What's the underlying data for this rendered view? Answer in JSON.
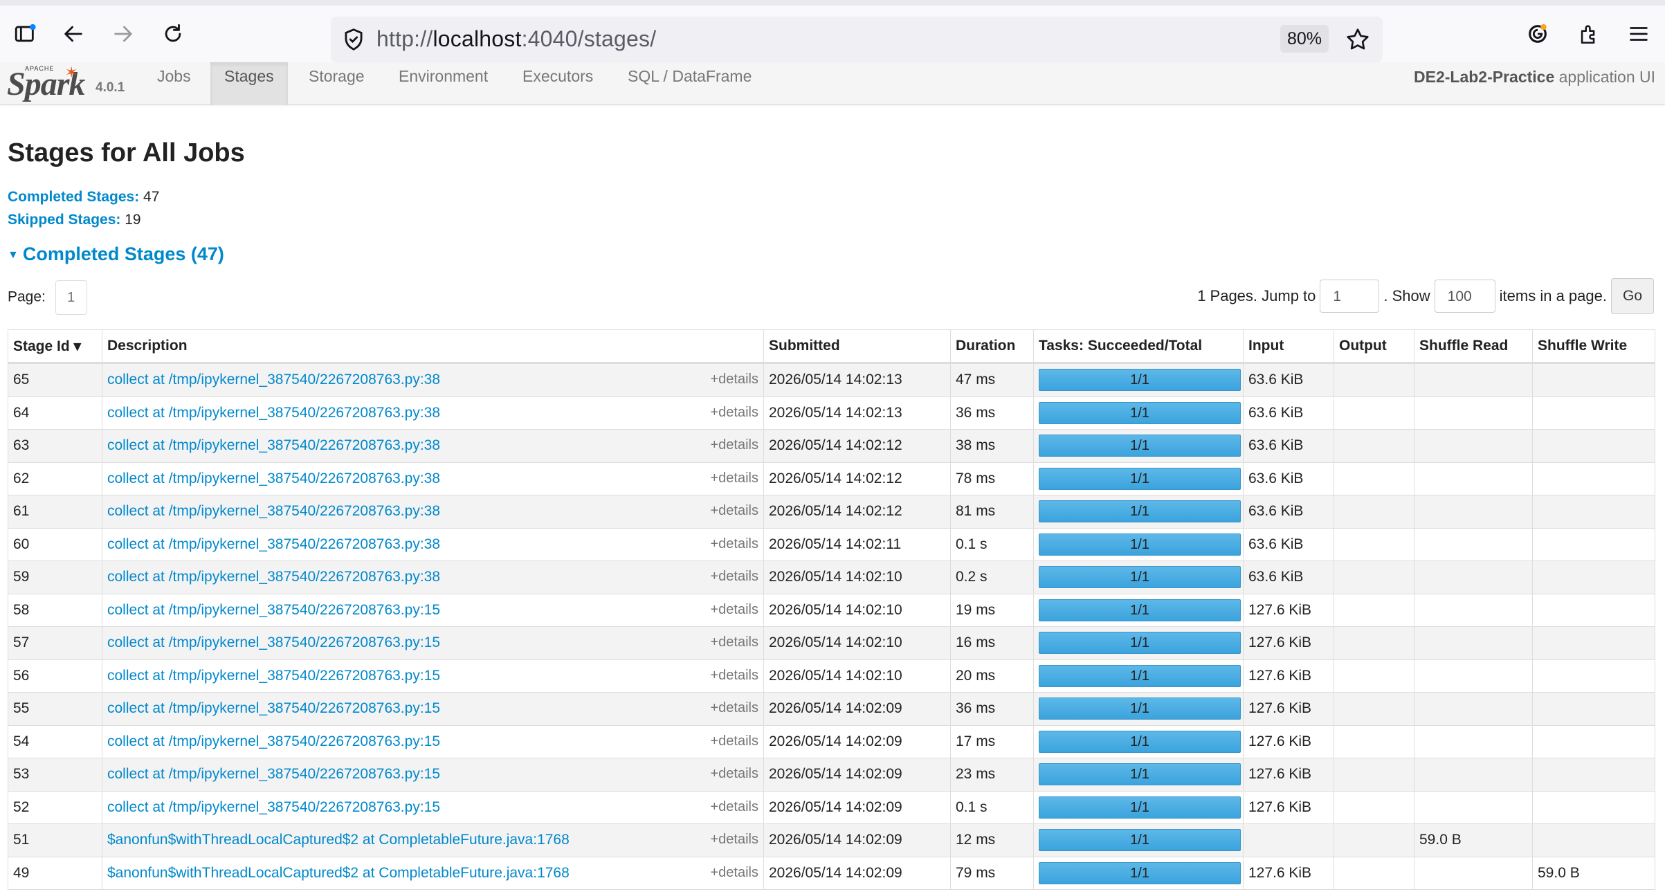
{
  "browser": {
    "url_scheme": "http://",
    "url_host": "localhost",
    "url_rest": ":4040/stages/",
    "zoom": "80%"
  },
  "nav": {
    "version": "4.0.1",
    "items": [
      "Jobs",
      "Stages",
      "Storage",
      "Environment",
      "Executors",
      "SQL / DataFrame"
    ],
    "active": "Stages",
    "app_name": "DE2-Lab2-Practice",
    "app_suffix": " application UI"
  },
  "page": {
    "title": "Stages for All Jobs",
    "completed_label": "Completed Stages:",
    "completed_value": " 47",
    "skipped_label": "Skipped Stages:",
    "skipped_value": " 19",
    "section_title": "Completed Stages (47)"
  },
  "pager": {
    "page_label": "Page:",
    "page_current": "1",
    "pages_text": "1 Pages. Jump to",
    "jump_value": "1",
    "show_text": ". Show",
    "show_value": "100",
    "items_text": "items in a page.",
    "go_label": "Go"
  },
  "table": {
    "headers": [
      "Stage Id ▾",
      "Description",
      "Submitted",
      "Duration",
      "Tasks: Succeeded/Total",
      "Input",
      "Output",
      "Shuffle Read",
      "Shuffle Write"
    ],
    "details_label": "+details",
    "rows": [
      {
        "id": "65",
        "desc": "collect at /tmp/ipykernel_387540/2267208763.py:38",
        "submitted": "2026/05/14 14:02:13",
        "duration": "47 ms",
        "tasks": "1/1",
        "input": "63.6 KiB",
        "output": "",
        "shuffle_read": "",
        "shuffle_write": ""
      },
      {
        "id": "64",
        "desc": "collect at /tmp/ipykernel_387540/2267208763.py:38",
        "submitted": "2026/05/14 14:02:13",
        "duration": "36 ms",
        "tasks": "1/1",
        "input": "63.6 KiB",
        "output": "",
        "shuffle_read": "",
        "shuffle_write": ""
      },
      {
        "id": "63",
        "desc": "collect at /tmp/ipykernel_387540/2267208763.py:38",
        "submitted": "2026/05/14 14:02:12",
        "duration": "38 ms",
        "tasks": "1/1",
        "input": "63.6 KiB",
        "output": "",
        "shuffle_read": "",
        "shuffle_write": ""
      },
      {
        "id": "62",
        "desc": "collect at /tmp/ipykernel_387540/2267208763.py:38",
        "submitted": "2026/05/14 14:02:12",
        "duration": "78 ms",
        "tasks": "1/1",
        "input": "63.6 KiB",
        "output": "",
        "shuffle_read": "",
        "shuffle_write": ""
      },
      {
        "id": "61",
        "desc": "collect at /tmp/ipykernel_387540/2267208763.py:38",
        "submitted": "2026/05/14 14:02:12",
        "duration": "81 ms",
        "tasks": "1/1",
        "input": "63.6 KiB",
        "output": "",
        "shuffle_read": "",
        "shuffle_write": ""
      },
      {
        "id": "60",
        "desc": "collect at /tmp/ipykernel_387540/2267208763.py:38",
        "submitted": "2026/05/14 14:02:11",
        "duration": "0.1 s",
        "tasks": "1/1",
        "input": "63.6 KiB",
        "output": "",
        "shuffle_read": "",
        "shuffle_write": ""
      },
      {
        "id": "59",
        "desc": "collect at /tmp/ipykernel_387540/2267208763.py:38",
        "submitted": "2026/05/14 14:02:10",
        "duration": "0.2 s",
        "tasks": "1/1",
        "input": "63.6 KiB",
        "output": "",
        "shuffle_read": "",
        "shuffle_write": ""
      },
      {
        "id": "58",
        "desc": "collect at /tmp/ipykernel_387540/2267208763.py:15",
        "submitted": "2026/05/14 14:02:10",
        "duration": "19 ms",
        "tasks": "1/1",
        "input": "127.6 KiB",
        "output": "",
        "shuffle_read": "",
        "shuffle_write": ""
      },
      {
        "id": "57",
        "desc": "collect at /tmp/ipykernel_387540/2267208763.py:15",
        "submitted": "2026/05/14 14:02:10",
        "duration": "16 ms",
        "tasks": "1/1",
        "input": "127.6 KiB",
        "output": "",
        "shuffle_read": "",
        "shuffle_write": ""
      },
      {
        "id": "56",
        "desc": "collect at /tmp/ipykernel_387540/2267208763.py:15",
        "submitted": "2026/05/14 14:02:10",
        "duration": "20 ms",
        "tasks": "1/1",
        "input": "127.6 KiB",
        "output": "",
        "shuffle_read": "",
        "shuffle_write": ""
      },
      {
        "id": "55",
        "desc": "collect at /tmp/ipykernel_387540/2267208763.py:15",
        "submitted": "2026/05/14 14:02:09",
        "duration": "36 ms",
        "tasks": "1/1",
        "input": "127.6 KiB",
        "output": "",
        "shuffle_read": "",
        "shuffle_write": ""
      },
      {
        "id": "54",
        "desc": "collect at /tmp/ipykernel_387540/2267208763.py:15",
        "submitted": "2026/05/14 14:02:09",
        "duration": "17 ms",
        "tasks": "1/1",
        "input": "127.6 KiB",
        "output": "",
        "shuffle_read": "",
        "shuffle_write": ""
      },
      {
        "id": "53",
        "desc": "collect at /tmp/ipykernel_387540/2267208763.py:15",
        "submitted": "2026/05/14 14:02:09",
        "duration": "23 ms",
        "tasks": "1/1",
        "input": "127.6 KiB",
        "output": "",
        "shuffle_read": "",
        "shuffle_write": ""
      },
      {
        "id": "52",
        "desc": "collect at /tmp/ipykernel_387540/2267208763.py:15",
        "submitted": "2026/05/14 14:02:09",
        "duration": "0.1 s",
        "tasks": "1/1",
        "input": "127.6 KiB",
        "output": "",
        "shuffle_read": "",
        "shuffle_write": ""
      },
      {
        "id": "51",
        "desc": "$anonfun$withThreadLocalCaptured$2 at CompletableFuture.java:1768",
        "submitted": "2026/05/14 14:02:09",
        "duration": "12 ms",
        "tasks": "1/1",
        "input": "",
        "output": "",
        "shuffle_read": "59.0 B",
        "shuffle_write": ""
      },
      {
        "id": "49",
        "desc": "$anonfun$withThreadLocalCaptured$2 at CompletableFuture.java:1768",
        "submitted": "2026/05/14 14:02:09",
        "duration": "79 ms",
        "tasks": "1/1",
        "input": "127.6 KiB",
        "output": "",
        "shuffle_read": "",
        "shuffle_write": "59.0 B"
      }
    ]
  },
  "colors": {
    "link": "#0088cc",
    "progress": "#3ba3dd",
    "spark_orange": "#e25a1c"
  }
}
